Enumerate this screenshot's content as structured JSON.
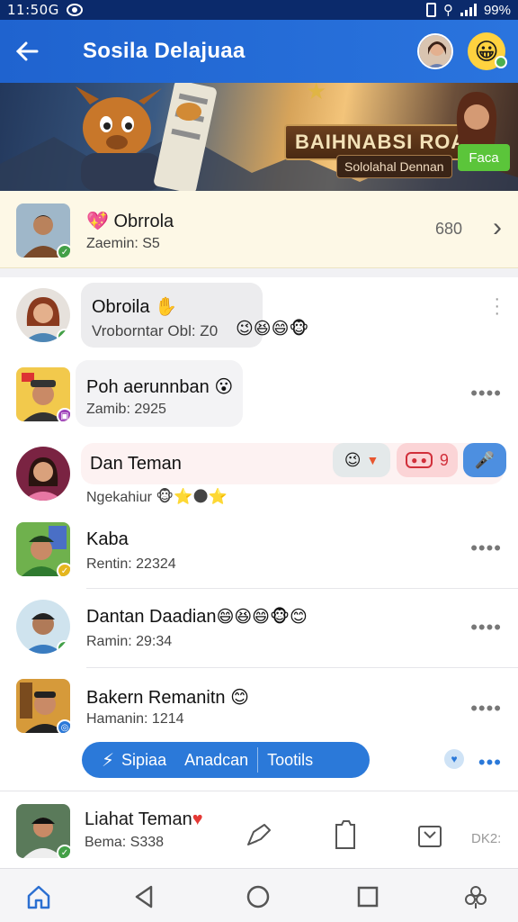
{
  "status": {
    "time": "11:50G",
    "battery": "99%"
  },
  "header": {
    "title": "Sosila Delajuaa",
    "back_label": "←"
  },
  "banner": {
    "title": "BAIHNABSI ROA",
    "subtitle": "Sololahal Dennan",
    "button_label": "Faca"
  },
  "pinned": {
    "name": "Obrrola",
    "sub": "Zaemin: S5",
    "count": "680"
  },
  "chats": [
    {
      "name": "Obroila",
      "sub": "Vroborntar Obl: Z0"
    },
    {
      "name": "Poh aerunnban",
      "sub": "Zamib: 2925"
    },
    {
      "name": "Dan Teman",
      "sub": "Ngekahiur"
    },
    {
      "name": "Kaba",
      "sub": "Rentin: 22324"
    },
    {
      "name": "Dantan Daadian",
      "sub": "Ramin: 29:34"
    },
    {
      "name": "Bakern Remanitn",
      "sub": "Hamanin: 1214"
    }
  ],
  "action_bar": {
    "a": "Sipiaa",
    "b": "Anadcan",
    "c": "Tootils"
  },
  "bottom": {
    "name": "Liahat Teman",
    "sub": "Bema: S338",
    "code": "DK2:"
  },
  "pills": {
    "p2": "9"
  }
}
